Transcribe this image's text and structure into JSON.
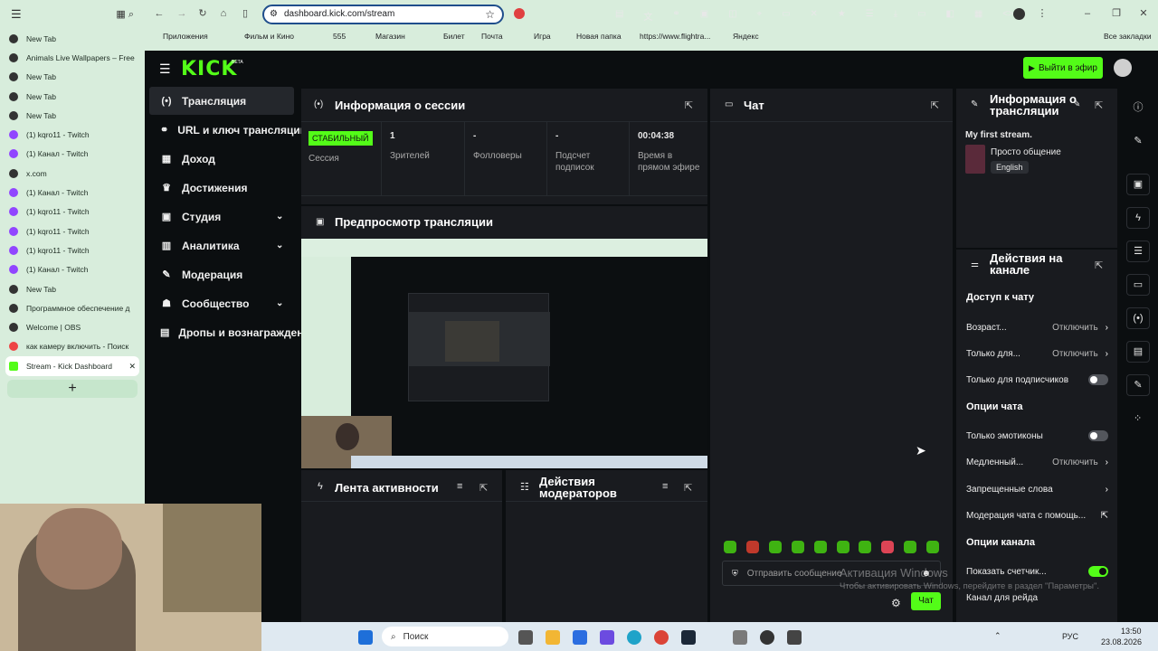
{
  "browser": {
    "tabs": [
      "New Tab",
      "Animals Live Wallpapers – Free",
      "New Tab",
      "New Tab",
      "New Tab",
      "(1) kqro11 - Twitch",
      "(1) Канал - Twitch",
      "x.com",
      "(1) Канал - Twitch",
      "(1) kqro11 - Twitch",
      "(1) kqro11 - Twitch",
      "(1) kqro11 - Twitch",
      "(1) Канал - Twitch",
      "New Tab",
      "Программное обеспечение д",
      "Welcome | OBS",
      "как камеру включить - Поиск",
      "Stream - Kick Dashboard"
    ],
    "url": "dashboard.kick.com/stream",
    "bookmarks": [
      "Приложения",
      "Фильм и Кино",
      "555",
      "Магазин",
      "Билет",
      "Почта",
      "Игра",
      "Новая папка",
      "https://www.flightra...",
      "Яндекс",
      "Все закладки"
    ]
  },
  "kick": {
    "logo": "KICK",
    "beta": "BETA",
    "go_live": "Выйти в эфир",
    "nav": [
      "Трансляция",
      "URL и ключ трансляции",
      "Доход",
      "Достижения",
      "Студия",
      "Аналитика",
      "Модерация",
      "Сообщество",
      "Дропы и вознаграждения"
    ],
    "session": {
      "title": "Информация о сессии",
      "badge": "СТАБИЛЬНЫЙ",
      "session_label": "Сессия",
      "stats": [
        {
          "value": "1",
          "label": "Зрителей"
        },
        {
          "value": "-",
          "label": "Фолловеры"
        },
        {
          "value": "-",
          "label": "Подсчет подписок"
        },
        {
          "value": "00:04:38",
          "label": "Время в прямом эфире"
        }
      ]
    },
    "preview": {
      "title": "Предпросмотр трансляции"
    },
    "activity": {
      "title": "Лента активности"
    },
    "mod_actions": {
      "title": "Действия модераторов"
    },
    "chat": {
      "title": "Чат",
      "placeholder": "Отправить сообщение",
      "send": "Чат"
    },
    "stream_info": {
      "title": "Информация о трансляции",
      "stream_title": "My first stream.",
      "category": "Просто общение",
      "language": "English"
    },
    "channel_actions": {
      "title": "Действия на канале",
      "chat_access": "Доступ к чату",
      "chat_rows": [
        {
          "label": "Возраст...",
          "value": "Отключить"
        },
        {
          "label": "Только для...",
          "value": "Отключить"
        },
        {
          "label": "Только для подписчиков",
          "value": ""
        }
      ],
      "chat_options": "Опции чата",
      "option_rows": [
        {
          "label": "Только эмотиконы",
          "value": ""
        },
        {
          "label": "Медленный...",
          "value": "Отключить"
        },
        {
          "label": "Запрещенные слова",
          "value": ""
        },
        {
          "label": "Модерация чата с помощь...",
          "value": ""
        }
      ],
      "channel_options": "Опции канала",
      "channel_rows": [
        {
          "label": "Показать счетчик...",
          "value": ""
        },
        {
          "label": "Канал для рейда",
          "value": ""
        }
      ]
    }
  },
  "watermark": {
    "line1": "Активация Windows",
    "line2": "Чтобы активировать Windows, перейдите в раздел \"Параметры\"."
  },
  "taskbar": {
    "search": "Поиск",
    "lang": "РУС",
    "time": "13:50",
    "date": "23.08.2026"
  },
  "colors": {
    "accent": "#53fc18",
    "panel": "#191b1f",
    "bg": "#0b0e10"
  }
}
